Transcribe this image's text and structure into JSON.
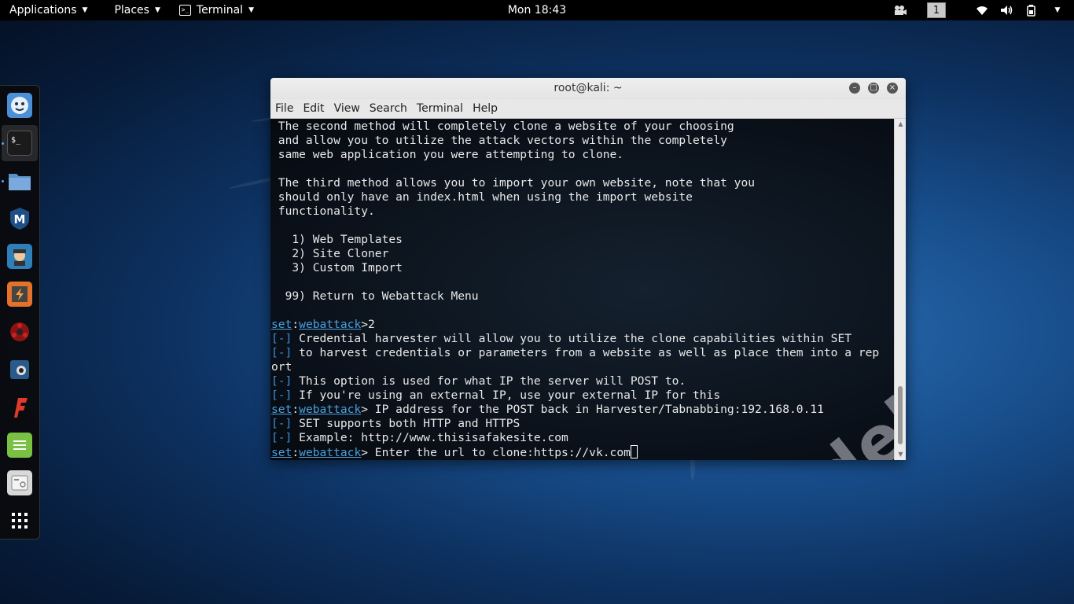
{
  "topbar": {
    "applications": "Applications",
    "places": "Places",
    "terminal": "Terminal",
    "clock": "Mon 18:43",
    "workspace": "1"
  },
  "dock": {
    "items": [
      "finder-icon",
      "terminal-icon",
      "files-icon",
      "metasploit-icon",
      "armitage-icon",
      "burpsuite-icon",
      "faraday-icon",
      "maltego-icon",
      "flashfire-icon",
      "notes-icon",
      "dictionary-icon",
      "app-grid-icon"
    ]
  },
  "window": {
    "title": "root@kali: ~",
    "menu": [
      "File",
      "Edit",
      "View",
      "Search",
      "Terminal",
      "Help"
    ]
  },
  "terminal": {
    "l1": " The second method will completely clone a website of your choosing",
    "l2": " and allow you to utilize the attack vectors within the completely",
    "l3": " same web application you were attempting to clone.",
    "l5": " The third method allows you to import your own website, note that you",
    "l6": " should only have an index.html when using the import website",
    "l7": " functionality.",
    "m1": "   1) Web Templates",
    "m2": "   2) Site Cloner",
    "m3": "   3) Custom Import",
    "m99": "  99) Return to Webattack Menu",
    "prompt_set": "set",
    "prompt_colon": ":",
    "prompt_wa": "webattack",
    "p1": ">2",
    "info": "[-]",
    "i1": " Credential harvester will allow you to utilize the clone capabilities within SET",
    "i2": " to harvest credentials or parameters from a website as well as place them into a rep",
    "i2b": "ort",
    "i3": " This option is used for what IP the server will POST to.",
    "i4": " If you're using an external IP, use your external IP for this",
    "p2": "> IP address for the POST back in Harvester/Tabnabbing:192.168.0.11",
    "i5": " SET supports both HTTP and HTTPS",
    "i6": " Example: http://www.thisisafakesite.com",
    "p3": "> Enter the url to clone:https://vk.com"
  },
  "watermark": "codeby.net"
}
